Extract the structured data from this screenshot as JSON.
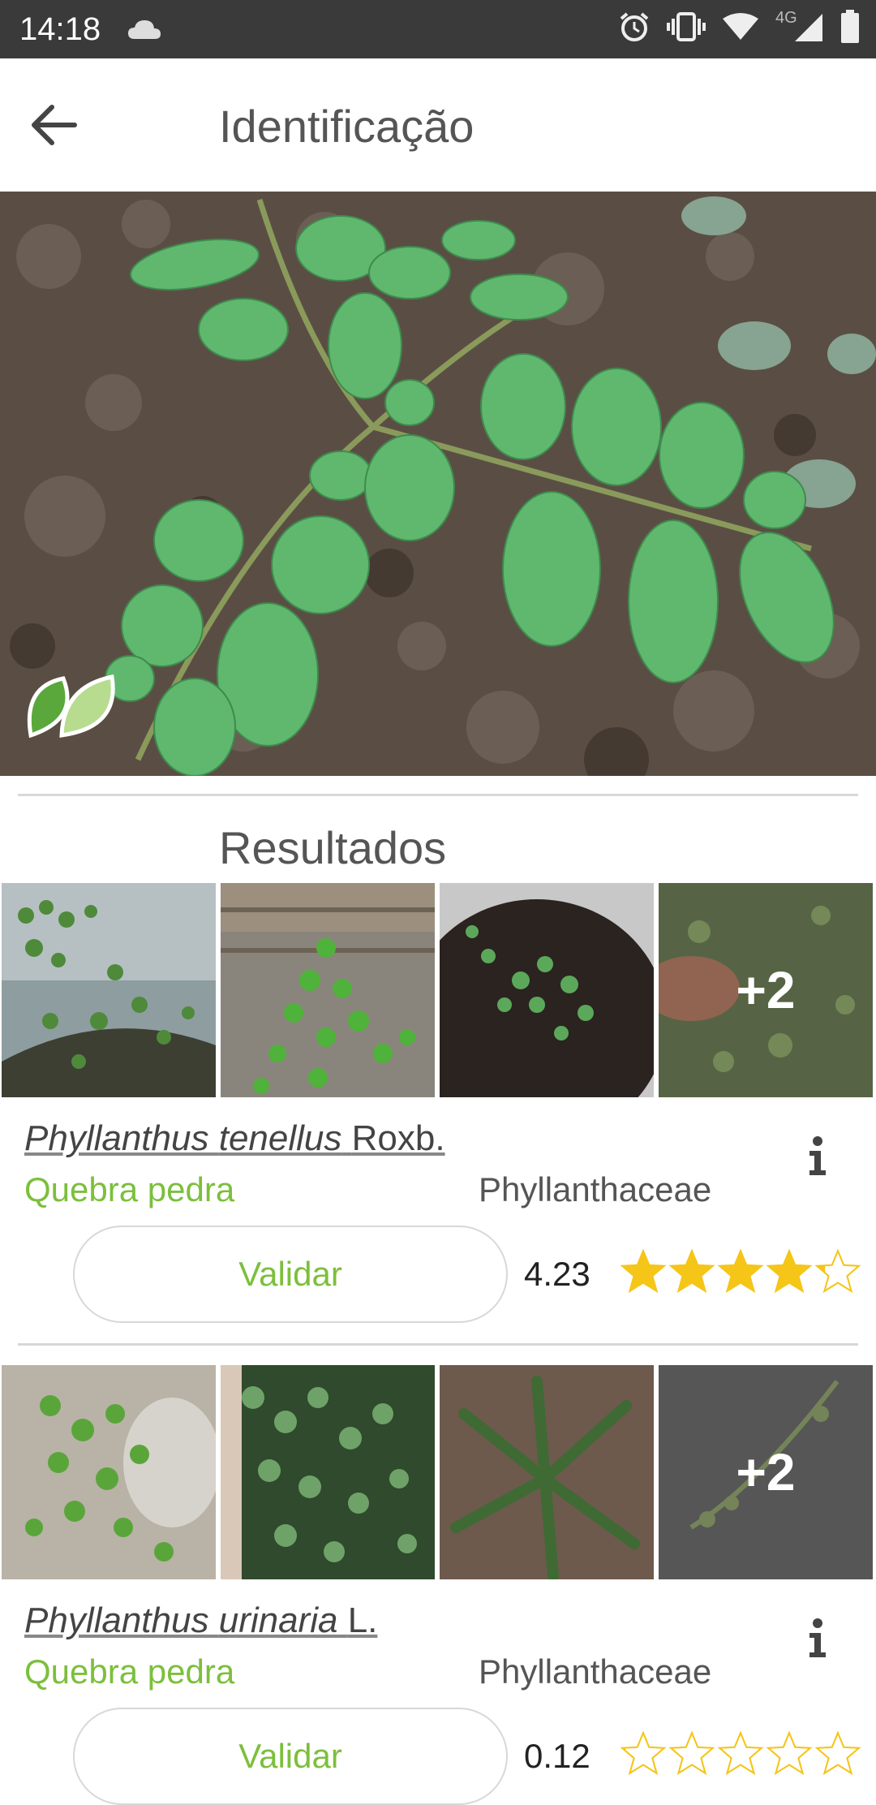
{
  "status_bar": {
    "time": "14:18",
    "network": "4G"
  },
  "app_bar": {
    "title": "Identificação"
  },
  "results": {
    "title": "Resultados",
    "items": [
      {
        "genus": "Phyllanthus",
        "species": "tenellus",
        "author": "Roxb.",
        "common_name": "Quebra pedra",
        "family": "Phyllanthaceae",
        "validate_label": "Validar",
        "score": "4.23",
        "rating": 4.23,
        "more_label": "+2"
      },
      {
        "genus": "Phyllanthus",
        "species": "urinaria",
        "author": "L.",
        "common_name": "Quebra pedra",
        "family": "Phyllanthaceae",
        "validate_label": "Validar",
        "score": "0.12",
        "rating": 0.12,
        "more_label": "+2"
      }
    ]
  },
  "colors": {
    "accent_green": "#7cbf3c",
    "star_gold": "#f5c518",
    "status_bar": "#3a3a3a"
  }
}
